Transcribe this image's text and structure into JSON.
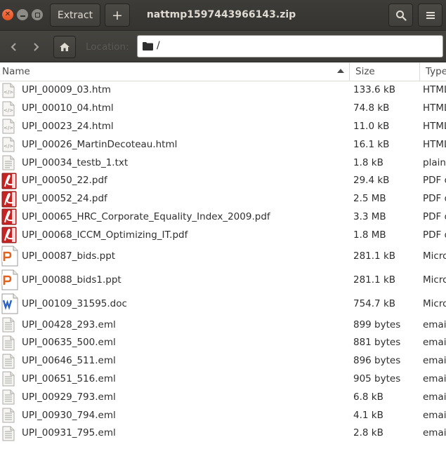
{
  "window": {
    "title": "nattmp1597443966143.zip",
    "extract_label": "Extract",
    "add_label": "+"
  },
  "toolbar": {
    "location_label": "Location:",
    "location_path": "/"
  },
  "columns": {
    "name": "Name",
    "size": "Size",
    "type": "Type"
  },
  "files": [
    {
      "name": "UPI_00009_03.htm",
      "size": "133.6 kB",
      "type": "HTML",
      "icon": "html-file-icon"
    },
    {
      "name": "UPI_00010_04.html",
      "size": "74.8 kB",
      "type": "HTML",
      "icon": "html-file-icon"
    },
    {
      "name": "UPI_00023_24.html",
      "size": "11.0 kB",
      "type": "HTML",
      "icon": "html-file-icon"
    },
    {
      "name": "UPI_00026_MartinDecoteau.html",
      "size": "16.1 kB",
      "type": "HTML",
      "icon": "html-file-icon"
    },
    {
      "name": "UPI_00034_testb_1.txt",
      "size": "1.8 kB",
      "type": "plain",
      "icon": "text-file-icon"
    },
    {
      "name": "UPI_00050_22.pdf",
      "size": "29.4 kB",
      "type": "PDF d",
      "icon": "pdf-file-icon"
    },
    {
      "name": "UPI_00052_24.pdf",
      "size": "2.5 MB",
      "type": "PDF d",
      "icon": "pdf-file-icon"
    },
    {
      "name": "UPI_00065_HRC_Corporate_Equality_Index_2009.pdf",
      "size": "3.3 MB",
      "type": "PDF d",
      "icon": "pdf-file-icon"
    },
    {
      "name": "UPI_00068_ICCM_Optimizing_IT.pdf",
      "size": "1.8 MB",
      "type": "PDF d",
      "icon": "pdf-file-icon"
    },
    {
      "name": "UPI_00087_bids.ppt",
      "size": "281.1 kB",
      "type": "Micro",
      "icon": "presentation-file-icon"
    },
    {
      "name": "UPI_00088_bids1.ppt",
      "size": "281.1 kB",
      "type": "Micro",
      "icon": "presentation-file-icon"
    },
    {
      "name": "UPI_00109_31595.doc",
      "size": "754.7 kB",
      "type": "Micro",
      "icon": "word-file-icon"
    },
    {
      "name": "UPI_00428_293.eml",
      "size": "899 bytes",
      "type": "email",
      "icon": "email-file-icon"
    },
    {
      "name": "UPI_00635_500.eml",
      "size": "881 bytes",
      "type": "email",
      "icon": "email-file-icon"
    },
    {
      "name": "UPI_00646_511.eml",
      "size": "896 bytes",
      "type": "email",
      "icon": "email-file-icon"
    },
    {
      "name": "UPI_00651_516.eml",
      "size": "905 bytes",
      "type": "email",
      "icon": "email-file-icon"
    },
    {
      "name": "UPI_00929_793.eml",
      "size": "6.8 kB",
      "type": "email",
      "icon": "email-file-icon"
    },
    {
      "name": "UPI_00930_794.eml",
      "size": "4.1 kB",
      "type": "email",
      "icon": "email-file-icon"
    },
    {
      "name": "UPI_00931_795.eml",
      "size": "2.8 kB",
      "type": "email",
      "icon": "email-file-icon"
    }
  ]
}
